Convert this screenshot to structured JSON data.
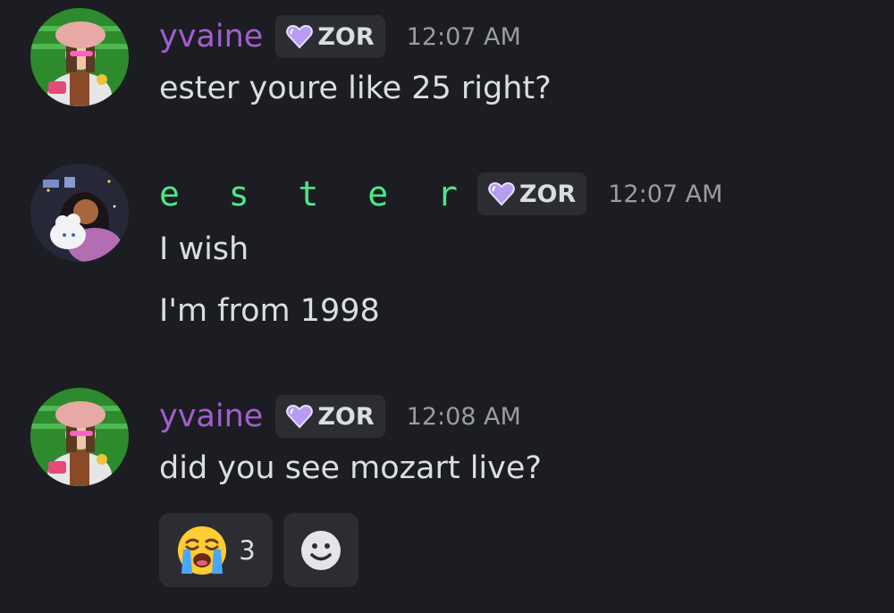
{
  "messages": [
    {
      "username": "yvaine",
      "tag": "ZOR",
      "timestamp": "12:07 AM",
      "lines": [
        "ester youre like 25 right?"
      ]
    },
    {
      "username": "e s t e r",
      "tag": "ZOR",
      "timestamp": "12:07 AM",
      "lines": [
        "I wish",
        "I'm from 1998"
      ]
    },
    {
      "username": "yvaine",
      "tag": "ZOR",
      "timestamp": "12:08 AM",
      "lines": [
        "did you see mozart live?"
      ]
    }
  ],
  "reactions": [
    {
      "emoji": "loudly-crying-face",
      "count": "3"
    },
    {
      "emoji": "add-reaction-smiley",
      "count": ""
    }
  ],
  "colors": {
    "background": "#1c1d22",
    "username_yvaine": "#a25fd0",
    "username_ester": "#4de88a",
    "tag_bg": "#2b2d33",
    "timestamp": "#9a9ca3",
    "text": "#dbdee1",
    "heart": "#b79cf2"
  }
}
